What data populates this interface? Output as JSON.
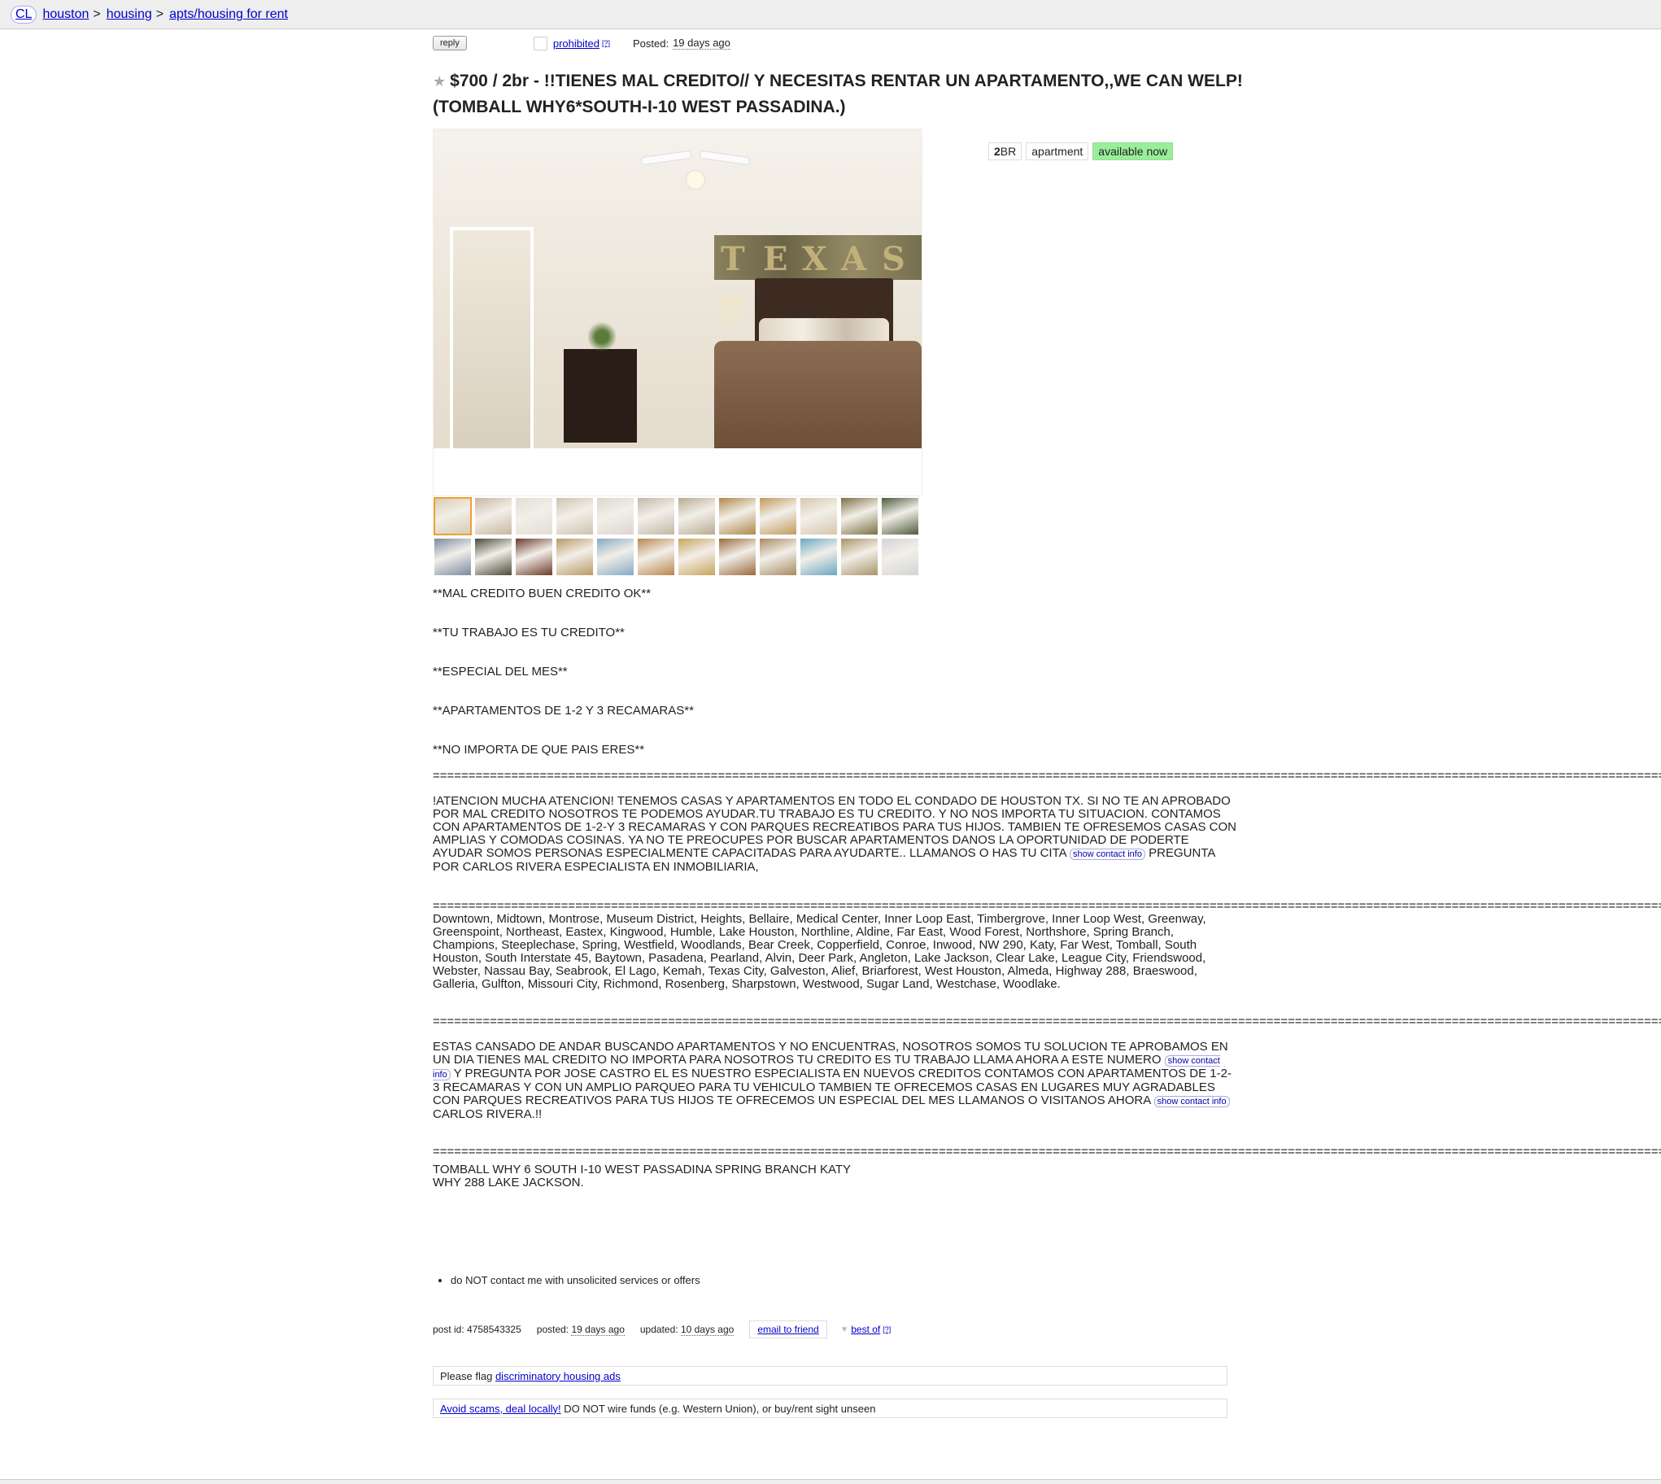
{
  "breadcrumb": {
    "logo": "CL",
    "items": [
      "houston",
      "housing",
      "apts/housing for rent"
    ],
    "separator": ">"
  },
  "postheader": {
    "reply_label": "reply",
    "prohibited_label": "prohibited",
    "help_mark": "[?]",
    "posted_label": "Posted:",
    "posted_date": "19 days ago"
  },
  "title": {
    "price": "$700",
    "bedrooms": "2br",
    "text": "!!TIENES MAL CREDITO// Y NECESITAS RENTAR UN APARTAMENTO,,WE CAN WELP! (TOMBALL WHY6*SOUTH-I-10 WEST PASSADINA.)"
  },
  "attrs": {
    "br_num": "2",
    "br_unit": "BR",
    "type": "apartment",
    "availability": "available now"
  },
  "colors": {
    "link": "#0000cc",
    "available_bg": "#99ee99",
    "thumb_selected": "#f0a030",
    "topbar_bg": "#eeeeee"
  },
  "body": {
    "line1": "**MAL CREDITO BUEN CREDITO OK**",
    "line2": "**TU TRABAJO ES TU CREDITO**",
    "line3": "**ESPECIAL DEL MES**",
    "line4": "**APARTAMENTOS DE 1-2 Y 3 RECAMARAS**",
    "line5": "**NO IMPORTA DE QUE PAIS ERES**",
    "rule": "==================================================================================================================================================================================================================================================",
    "para1_a": "!ATENCION MUCHA ATENCION! TENEMOS CASAS Y APARTAMENTOS EN TODO EL CONDADO DE HOUSTON TX. SI NO TE AN APROBADO POR MAL CREDITO NOSOTROS TE PODEMOS AYUDAR.TU TRABAJO ES TU CREDITO. Y NO NOS IMPORTA TU SITUACION. CONTAMOS CON APARTAMENTOS DE 1-2-Y 3 RECAMARAS Y CON PARQUES RECREATIBOS PARA TUS HIJOS. TAMBIEN TE OFRESEMOS CASAS CON AMPLIAS Y COMODAS COSINAS. YA NO TE PREOCUPES POR BUSCAR APARTAMENTOS DANOS LA OPORTUNIDAD DE PODERTE AYUDAR SOMOS PERSONAS ESPECIALMENTE CAPACITADAS PARA AYUDARTE.. LLAMANOS O HAS TU CITA",
    "para1_b": "PREGUNTA POR CARLOS RIVERA ESPECIALISTA EN INMOBILIARIA,",
    "para2": "Downtown, Midtown, Montrose, Museum District, Heights, Bellaire, Medical Center, Inner Loop East, Timbergrove, Inner Loop West, Greenway, Greenspoint, Northeast, Eastex, Kingwood, Humble, Lake Houston, Northline, Aldine, Far East, Wood Forest, Northshore, Spring Branch, Champions, Steeplechase, Spring, Westfield, Woodlands, Bear Creek, Copperfield, Conroe, Inwood, NW 290, Katy, Far West, Tomball, South Houston, South Interstate 45, Baytown, Pasadena, Pearland, Alvin, Deer Park, Angleton, Lake Jackson, Clear Lake, League City, Friendswood, Webster, Nassau Bay, Seabrook, El Lago, Kemah, Texas City, Galveston, Alief, Briarforest, West Houston, Almeda, Highway 288, Braeswood, Galleria, Gulfton, Missouri City, Richmond, Rosenberg, Sharpstown, Westwood, Sugar Land, Westchase, Woodlake.",
    "para3_a": "ESTAS CANSADO DE ANDAR BUSCANDO APARTAMENTOS Y NO ENCUENTRAS, NOSOTROS SOMOS TU SOLUCION TE APROBAMOS EN UN DIA TIENES MAL CREDITO NO IMPORTA PARA NOSOTROS TU CREDITO ES TU TRABAJO LLAMA AHORA A ESTE NUMERO",
    "para3_b": "Y PREGUNTA POR JOSE CASTRO EL ES NUESTRO ESPECIALISTA EN NUEVOS CREDITOS CONTAMOS CON APARTAMENTOS DE 1-2-3 RECAMARAS Y CON UN AMPLIO PARQUEO PARA TU VEHICULO TAMBIEN TE OFRECEMOS CASAS EN LUGARES MUY AGRADABLES CON PARQUES RECREATIVOS PARA TUS HIJOS TE OFRECEMOS UN ESPECIAL DEL MES LLAMANOS O VISITANOS AHORA",
    "para3_c": "CARLOS RIVERA.!!",
    "para4_line1": "TOMBALL WHY 6 SOUTH I-10 WEST PASSADINA SPRING BRANCH KATY",
    "para4_line2": "WHY 288 LAKE JACKSON.",
    "show_contact": "show contact info"
  },
  "notices": [
    "do NOT contact me with unsolicited services or offers"
  ],
  "postinfo": {
    "post_id": "post id: 4758543325",
    "posted_label": "posted:",
    "posted_date": "19 days ago",
    "updated_label": "updated:",
    "updated_date": "10 days ago",
    "email_friend": "email to friend",
    "best_of": "best of",
    "help_mark": "[?]"
  },
  "flag_notice": {
    "prefix": "Please flag",
    "link": "discriminatory housing ads"
  },
  "scam_notice": {
    "link": "Avoid scams, deal locally!",
    "text": "DO NOT wire funds (e.g. Western Union), or buy/rent sight unseen"
  },
  "gallery": {
    "main_image": "bedroom-photo",
    "main_image_letters": [
      "T",
      "E",
      "X",
      "A",
      "S"
    ],
    "thumbnail_count": 24,
    "selected_index": 0
  }
}
